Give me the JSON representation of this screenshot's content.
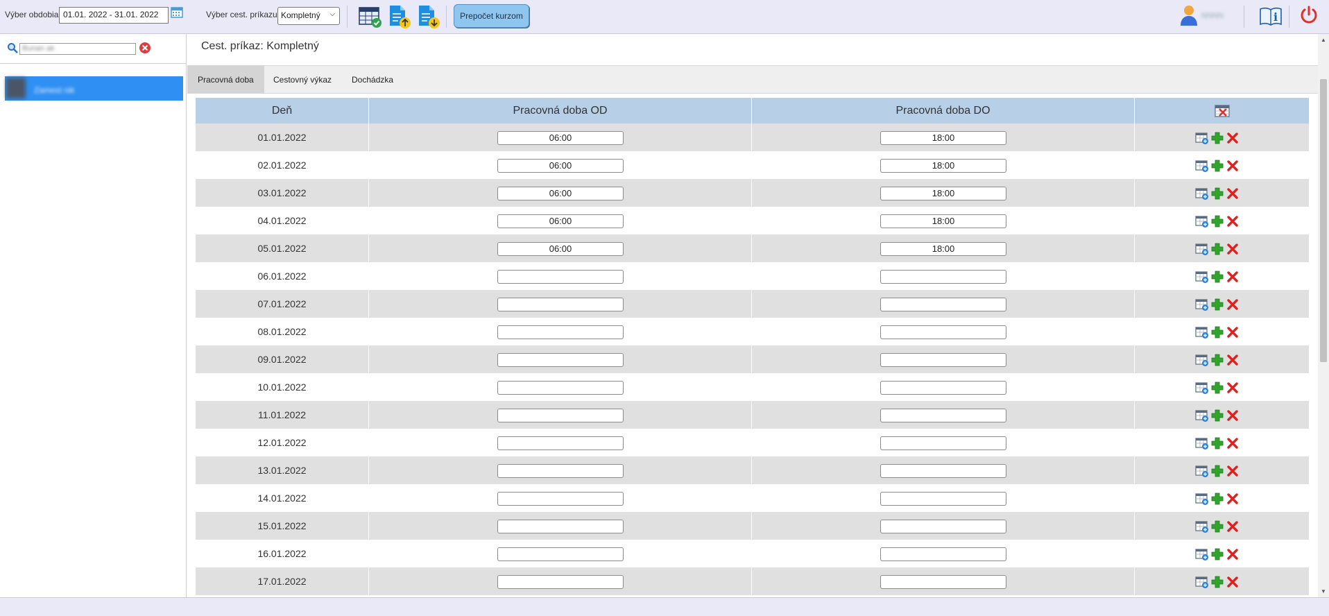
{
  "toolbar": {
    "period_label": "Výber obdobia",
    "period_value": "01.01. 2022 - 31.01. 2022",
    "order_label": "Výber cest. príkazu",
    "order_value": "Kompletný",
    "recalc_label": "Prepočet kurzom",
    "user_name": "NNNN"
  },
  "sidebar": {
    "search_placeholder": "Bunan ak",
    "employee_name": "Zamest nik"
  },
  "main": {
    "title": "Cest. príkaz: Kompletný",
    "tabs": [
      {
        "label": "Pracovná doba",
        "active": true
      },
      {
        "label": "Cestovný výkaz",
        "active": false
      },
      {
        "label": "Dochádzka",
        "active": false
      }
    ]
  },
  "table": {
    "headers": {
      "day": "Deň",
      "od": "Pracovná doba OD",
      "do": "Pracovná doba DO"
    },
    "rows": [
      {
        "day": "01.01.2022",
        "od": "06:00",
        "do": "18:00"
      },
      {
        "day": "02.01.2022",
        "od": "06:00",
        "do": "18:00"
      },
      {
        "day": "03.01.2022",
        "od": "06:00",
        "do": "18:00"
      },
      {
        "day": "04.01.2022",
        "od": "06:00",
        "do": "18:00"
      },
      {
        "day": "05.01.2022",
        "od": "06:00",
        "do": "18:00"
      },
      {
        "day": "06.01.2022",
        "od": "",
        "do": ""
      },
      {
        "day": "07.01.2022",
        "od": "",
        "do": ""
      },
      {
        "day": "08.01.2022",
        "od": "",
        "do": ""
      },
      {
        "day": "09.01.2022",
        "od": "",
        "do": ""
      },
      {
        "day": "10.01.2022",
        "od": "",
        "do": ""
      },
      {
        "day": "11.01.2022",
        "od": "",
        "do": ""
      },
      {
        "day": "12.01.2022",
        "od": "",
        "do": ""
      },
      {
        "day": "13.01.2022",
        "od": "",
        "do": ""
      },
      {
        "day": "14.01.2022",
        "od": "",
        "do": ""
      },
      {
        "day": "15.01.2022",
        "od": "",
        "do": ""
      },
      {
        "day": "16.01.2022",
        "od": "",
        "do": ""
      },
      {
        "day": "17.01.2022",
        "od": "",
        "do": ""
      }
    ]
  },
  "colors": {
    "toolbar_bg": "#e9e9f7",
    "selected_blue": "#2f8ff3",
    "header_blue": "#b8cfe8",
    "row_alt": "#e0e0e0",
    "recalc_button": "#8ec6f0"
  }
}
